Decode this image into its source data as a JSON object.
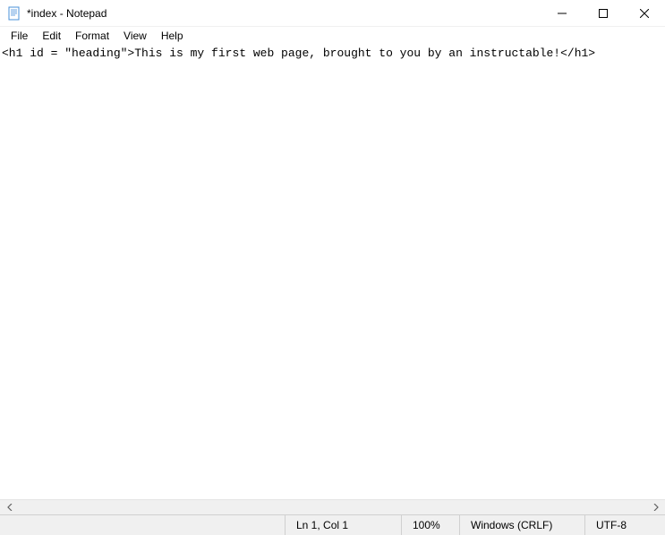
{
  "titlebar": {
    "title": "*index - Notepad"
  },
  "menubar": {
    "items": [
      "File",
      "Edit",
      "Format",
      "View",
      "Help"
    ]
  },
  "editor": {
    "content": "<h1 id = \"heading\">This is my first web page, brought to you by an instructable!</h1>"
  },
  "statusbar": {
    "position": "Ln 1, Col 1",
    "zoom": "100%",
    "line_ending": "Windows (CRLF)",
    "encoding": "UTF-8"
  }
}
